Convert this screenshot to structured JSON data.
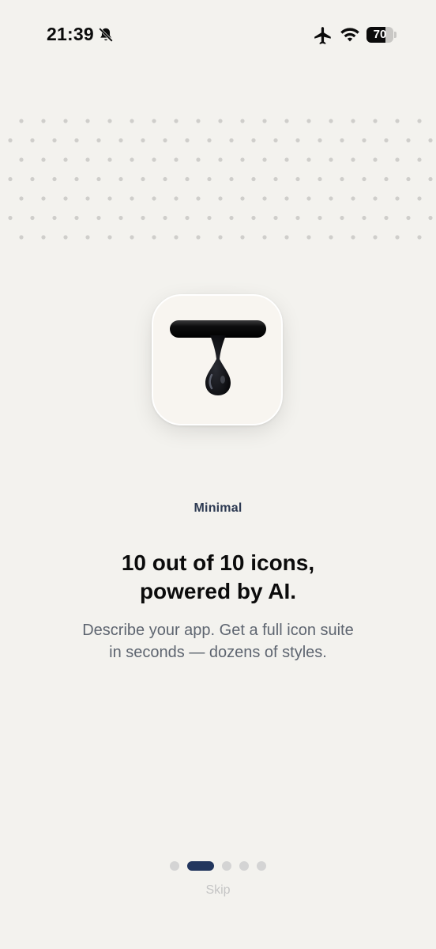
{
  "status_bar": {
    "time": "21:39",
    "battery_percent": "70",
    "icons": [
      "bell-muted-icon",
      "airplane-icon",
      "wifi-icon",
      "battery-icon"
    ]
  },
  "decoration": {
    "dot_color": "#cfcecb"
  },
  "onboarding": {
    "style_name": "Minimal",
    "headline_line1": "10 out of 10 icons,",
    "headline_line2": "powered by AI.",
    "subtitle_line1": "Describe your app. Get a full icon suite",
    "subtitle_line2": "in seconds — dozens of styles.",
    "icon": "ink-drop-t-icon"
  },
  "pager": {
    "total_pages": 5,
    "active_index": 1,
    "active_color": "#22365e",
    "inactive_color": "#d4d4d4"
  },
  "footer": {
    "skip_label": "Skip"
  }
}
